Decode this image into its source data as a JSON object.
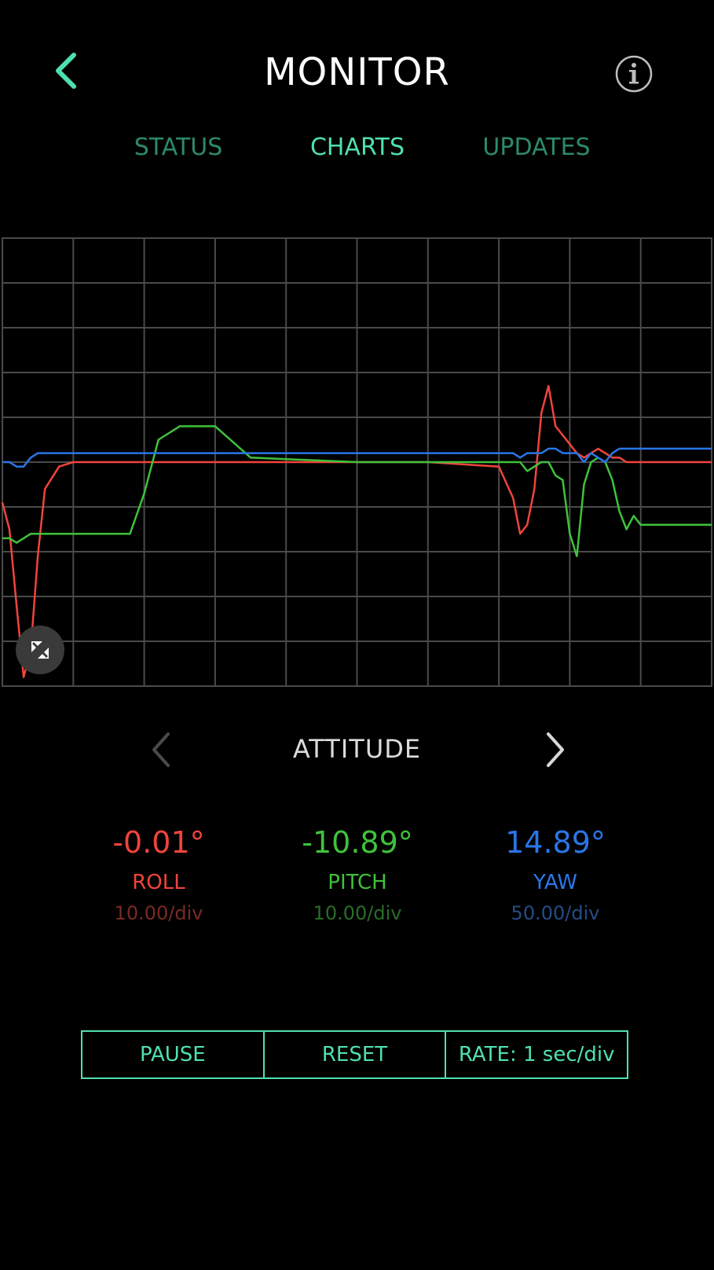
{
  "header": {
    "title": "MONITOR"
  },
  "tabs": [
    {
      "label": "STATUS",
      "active": false
    },
    {
      "label": "CHARTS",
      "active": true
    },
    {
      "label": "UPDATES",
      "active": false
    }
  ],
  "colors": {
    "accent": "#4fe0b0",
    "accent_dim": "#2c8a6a",
    "roll": "#f0443c",
    "pitch": "#3fc23b",
    "yaw": "#2a76e8",
    "grid": "#4a4a4a"
  },
  "series_nav": {
    "title": "ATTITUDE",
    "prev_enabled": false,
    "next_enabled": true
  },
  "readouts": [
    {
      "value": "-0.01°",
      "name": "ROLL",
      "scale": "10.00/div"
    },
    {
      "value": "-10.89°",
      "name": "PITCH",
      "scale": "10.00/div"
    },
    {
      "value": "14.89°",
      "name": "YAW",
      "scale": "50.00/div"
    }
  ],
  "controls": {
    "pause": "PAUSE",
    "reset": "RESET",
    "rate": "RATE: 1 sec/div"
  },
  "chart_data": {
    "type": "line",
    "grid": true,
    "x_divisions": 10,
    "y_divisions": 10,
    "x": [
      0,
      0.1,
      0.2,
      0.3,
      0.4,
      0.5,
      0.6,
      0.8,
      1.0,
      1.2,
      1.5,
      1.8,
      2.0,
      2.2,
      2.5,
      3.0,
      3.5,
      5.0,
      6.0,
      7.0,
      7.2,
      7.3,
      7.4,
      7.5,
      7.6,
      7.7,
      7.8,
      7.9,
      8.0,
      8.1,
      8.2,
      8.3,
      8.4,
      8.5,
      8.6,
      8.7,
      8.8,
      8.9,
      9.0,
      9.2,
      9.4,
      9.6,
      9.8,
      10.0
    ],
    "series": [
      {
        "name": "ROLL",
        "values": [
          4.1,
          3.5,
          1.8,
          0.2,
          0.8,
          2.9,
          4.4,
          4.9,
          5.0,
          5.0,
          5.0,
          5.0,
          5.0,
          5.0,
          5.0,
          5.0,
          5.0,
          5.0,
          5.0,
          4.9,
          4.2,
          3.4,
          3.6,
          4.4,
          6.1,
          6.7,
          5.8,
          5.6,
          5.4,
          5.2,
          5.1,
          5.2,
          5.3,
          5.2,
          5.1,
          5.1,
          5.0,
          5.0,
          5.0,
          5.0,
          5.0,
          5.0,
          5.0,
          5.0
        ]
      },
      {
        "name": "PITCH",
        "values": [
          3.3,
          3.3,
          3.2,
          3.3,
          3.4,
          3.4,
          3.4,
          3.4,
          3.4,
          3.4,
          3.4,
          3.4,
          4.3,
          5.5,
          5.8,
          5.8,
          5.1,
          5.0,
          5.0,
          5.0,
          5.0,
          5.0,
          4.8,
          4.9,
          5.0,
          5.0,
          4.7,
          4.6,
          3.4,
          2.9,
          4.5,
          5.0,
          5.1,
          5.0,
          4.6,
          3.9,
          3.5,
          3.8,
          3.6,
          3.6,
          3.6,
          3.6,
          3.6,
          3.6
        ]
      },
      {
        "name": "YAW",
        "values": [
          5.0,
          5.0,
          4.9,
          4.9,
          5.1,
          5.2,
          5.2,
          5.2,
          5.2,
          5.2,
          5.2,
          5.2,
          5.2,
          5.2,
          5.2,
          5.2,
          5.2,
          5.2,
          5.2,
          5.2,
          5.2,
          5.1,
          5.2,
          5.2,
          5.2,
          5.3,
          5.3,
          5.2,
          5.2,
          5.2,
          5.0,
          5.2,
          5.1,
          5.0,
          5.2,
          5.3,
          5.3,
          5.3,
          5.3,
          5.3,
          5.3,
          5.3,
          5.3,
          5.3
        ]
      }
    ],
    "xlim": [
      0,
      10
    ],
    "ylim": [
      0,
      10
    ]
  }
}
